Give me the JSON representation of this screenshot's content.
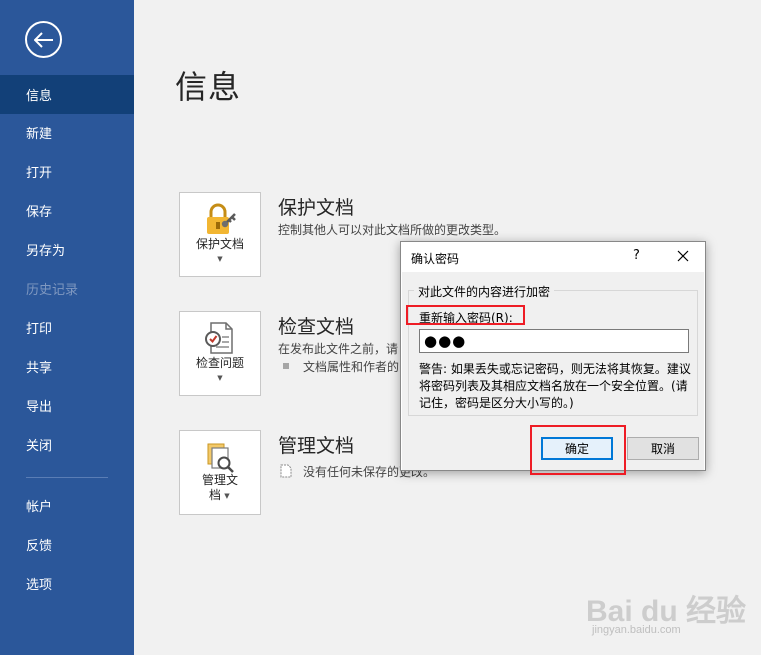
{
  "sidebar": {
    "items": [
      {
        "label": "信息"
      },
      {
        "label": "新建"
      },
      {
        "label": "打开"
      },
      {
        "label": "保存"
      },
      {
        "label": "另存为"
      },
      {
        "label": "历史记录"
      },
      {
        "label": "打印"
      },
      {
        "label": "共享"
      },
      {
        "label": "导出"
      },
      {
        "label": "关闭"
      },
      {
        "label": "帐户"
      },
      {
        "label": "反馈"
      },
      {
        "label": "选项"
      }
    ]
  },
  "main": {
    "title": "信息",
    "protect": {
      "tile_label": "保护文档",
      "title": "保护文档",
      "desc": "控制其他人可以对此文档所做的更改类型。"
    },
    "inspect": {
      "tile_label": "检查问题",
      "title": "检查文档",
      "desc": "在发布此文件之前，请",
      "bullet": "文档属性和作者的"
    },
    "manage": {
      "tile_label_line1": "管理文",
      "tile_label_line2": "档",
      "title": "管理文档",
      "desc": "没有任何未保存的更改。"
    }
  },
  "dialog": {
    "title": "确认密码",
    "help": "?",
    "group_label": "对此文件的内容进行加密",
    "reenter_label": "重新输入密码(R):",
    "password_value": "●●●",
    "warning": "警告: 如果丢失或忘记密码，则无法将其恢复。建议将密码列表及其相应文档名放在一个安全位置。(请记住，密码是区分大小写的。)",
    "ok_label": "确定",
    "cancel_label": "取消"
  },
  "watermark": {
    "logo": "Bai du 经验",
    "url": "jingyan.baidu.com"
  },
  "colors": {
    "sidebar": "#2b579a",
    "sidebar_active": "#124078",
    "highlight": "#ee1c25",
    "ok_focus": "#0078d7"
  }
}
